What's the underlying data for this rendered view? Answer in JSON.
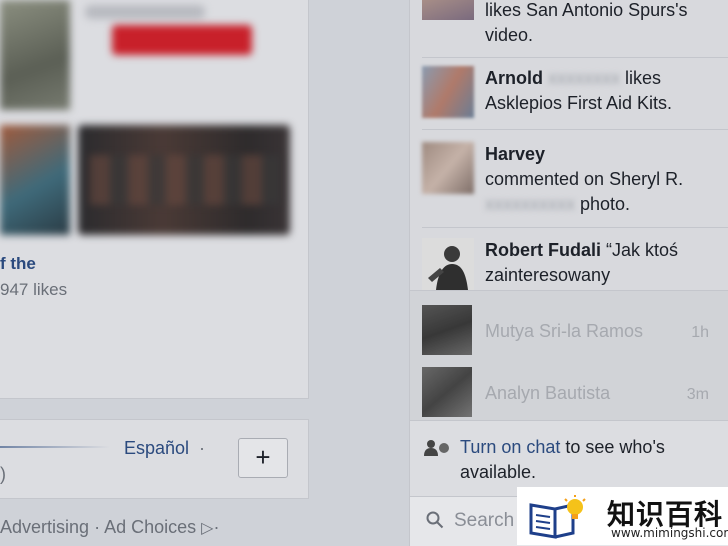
{
  "feed": {
    "link_text": "f the",
    "likes_text": "947 likes"
  },
  "languages": {
    "spanish": "Español",
    "separator": "·",
    "paren": ")",
    "add_button": "+"
  },
  "footer": {
    "advertising": "Advertising",
    "separator": "·",
    "ad_choices": "Ad Choices",
    "trailing": "·"
  },
  "ticker": [
    {
      "name": "",
      "text": "likes San Antonio Spurs's video."
    },
    {
      "name": "Arnold",
      "text": "likes Asklepios First Aid Kits."
    },
    {
      "name": "Harvey",
      "text": "commented on Sheryl R.",
      "text2": "photo."
    },
    {
      "name": "Robert Fudali",
      "text": "“Jak ktoś zainteresowany"
    }
  ],
  "chat": {
    "contacts": [
      {
        "name": "Mutya Sri-la Ramos",
        "time": "1h"
      },
      {
        "name": "Analyn Bautista",
        "time": "3m"
      }
    ],
    "notice_link": "Turn on chat",
    "notice_rest": " to see who's available."
  },
  "search": {
    "placeholder": "Search"
  },
  "watermark": {
    "cn": "知识百科",
    "url": "www.mimingshi.com"
  },
  "colors": {
    "link": "#2b4a7e",
    "muted": "#6a6f78",
    "panel": "#d8d9dd"
  }
}
